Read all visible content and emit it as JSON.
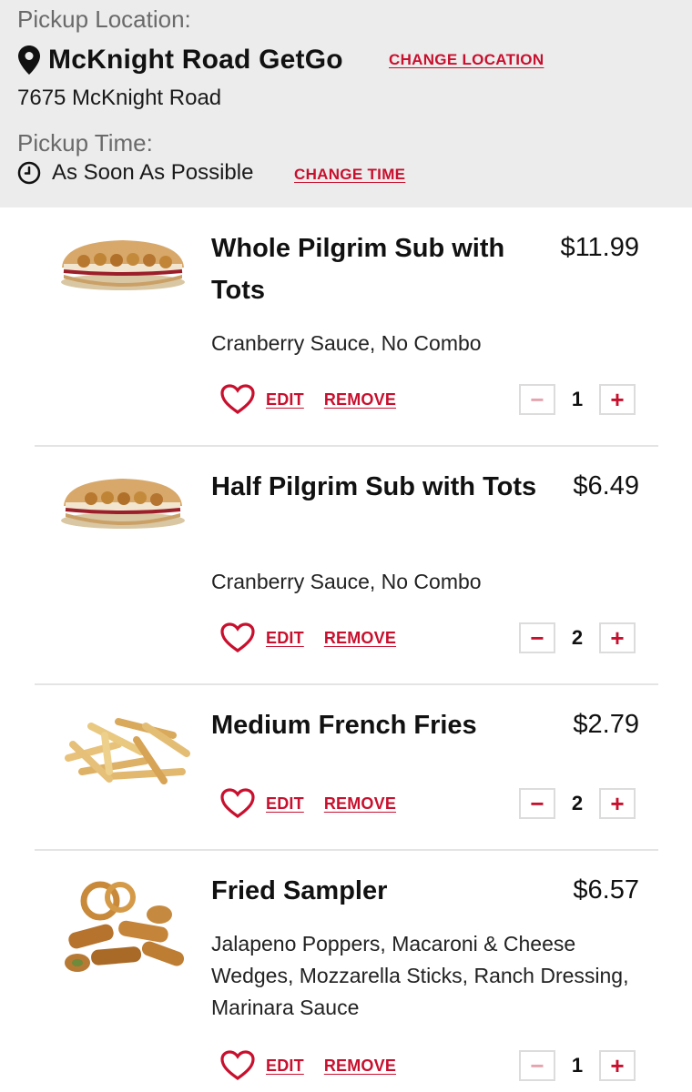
{
  "pickup": {
    "location_label": "Pickup Location:",
    "store_name": "McKnight Road GetGo",
    "change_location": "CHANGE LOCATION",
    "address": "7675 McKnight Road",
    "time_label": "Pickup Time:",
    "time_value": "As Soon As Possible",
    "change_time": "CHANGE TIME"
  },
  "actions": {
    "edit": "EDIT",
    "remove": "REMOVE",
    "minus": "−",
    "plus": "+"
  },
  "items": [
    {
      "name": "Whole Pilgrim Sub with Tots",
      "price": "$11.99",
      "mods": "Cranberry Sauce, No Combo",
      "qty": "1",
      "image": "whole-sub-image"
    },
    {
      "name": "Half Pilgrim Sub with Tots",
      "price": "$6.49",
      "mods": "Cranberry Sauce, No Combo",
      "qty": "2",
      "image": "half-sub-image"
    },
    {
      "name": "Medium French Fries",
      "price": "$2.79",
      "mods": "",
      "qty": "2",
      "image": "fries-image"
    },
    {
      "name": "Fried Sampler",
      "price": "$6.57",
      "mods": "Jalapeno Poppers, Macaroni & Cheese Wedges, Mozzarella Sticks, Ranch Dressing, Marinara Sauce",
      "qty": "1",
      "image": "sampler-image"
    }
  ],
  "colors": {
    "accent": "#c8102e",
    "header_bg": "#ececec"
  }
}
